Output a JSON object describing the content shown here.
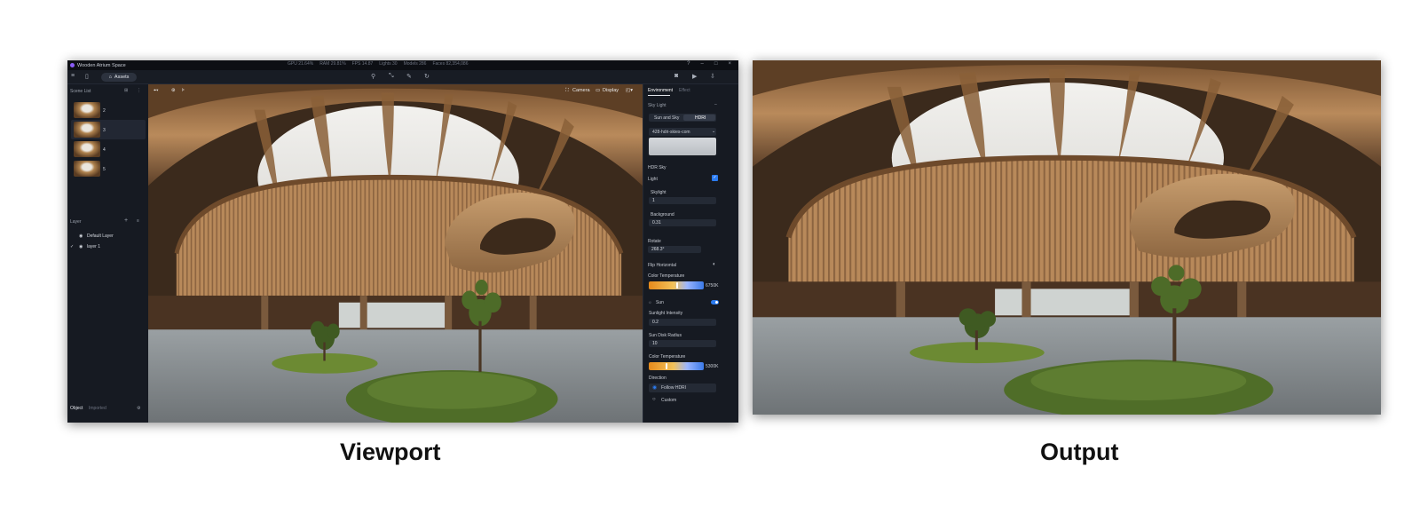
{
  "app": {
    "title": "Wooden Atrium Space",
    "stats": [
      "GPU 21.64%",
      "RAM 29.81%",
      "FPS 14.87",
      "Lights 30",
      "Models 286",
      "Faces 82,354,086"
    ],
    "assets_label": "Assets"
  },
  "left_panel": {
    "scene_list_title": "Scene List",
    "scenes": [
      {
        "label": "2"
      },
      {
        "label": "3"
      },
      {
        "label": "4"
      },
      {
        "label": "5"
      }
    ],
    "layer_title": "Layer",
    "layers": [
      {
        "label": "Default Layer",
        "checked": ""
      },
      {
        "label": "layer 1",
        "checked": "✓"
      }
    ],
    "bottom_tabs": [
      "Object",
      "Imported"
    ]
  },
  "viewport": {
    "camera_label": "Camera",
    "display_label": "Display"
  },
  "right_panel": {
    "tabs": [
      "Environment",
      "Effect"
    ],
    "sky_light_title": "Sky Light",
    "sky_modes": [
      "Sun and Sky",
      "HDRI"
    ],
    "hdri_name": "428-hdri-skies-com",
    "hdr_sky_title": "HDR Sky",
    "light_label": "Light",
    "skylight_label": "Skylight",
    "skylight_value": "1",
    "background_label": "Background",
    "background_value": "0.31",
    "rotate_label": "Rotate",
    "rotate_value": "268.3°",
    "flip_label": "Flip Horizontal",
    "color_temp_label": "Color Temperature",
    "color_temp_value": "6750K",
    "color_temp_fraction": 0.5,
    "sun_label": "Sun",
    "sunlight_intensity_label": "Sunlight Intensity",
    "sunlight_intensity_value": "0.2",
    "sun_disk_label": "Sun Disk Radius",
    "sun_disk_value": "10",
    "sun_color_temp_label": "Color Temperature",
    "sun_color_temp_value": "5300K",
    "sun_color_temp_fraction": 0.3,
    "direction_label": "Direction",
    "direction_options": [
      "Follow HDRI",
      "Custom"
    ]
  },
  "captions": {
    "viewport": "Viewport",
    "output": "Output"
  }
}
